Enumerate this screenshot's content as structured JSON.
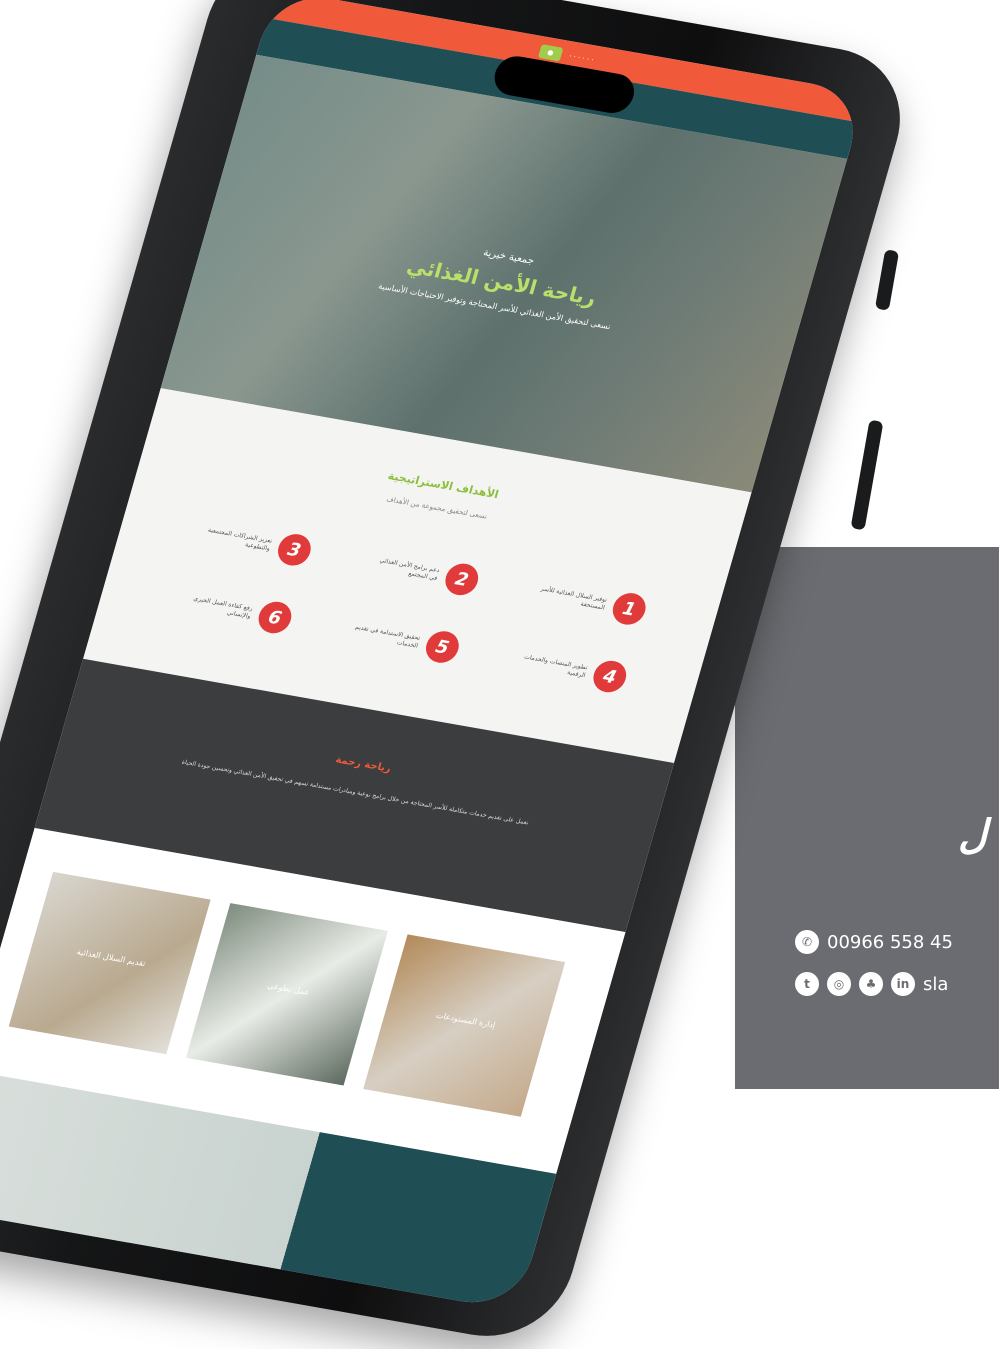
{
  "card": {
    "title": "ل",
    "phone": "00966 558 45",
    "handle": "sla",
    "icons": [
      "whatsapp-icon",
      "twitter-icon",
      "instagram-icon",
      "snapchat-icon",
      "linkedin-icon"
    ]
  },
  "phone_screen": {
    "hero": {
      "kicker": "جمعية خيرية",
      "title": "رياحة الأمن الغذائي",
      "description": "نسعى لتحقيق الأمن الغذائي للأسر المحتاجة وتوفير الاحتياجات الأساسية"
    },
    "goals": {
      "title": "الأهداف الاستراتيجية",
      "subtitle": "نسعى لتحقيق مجموعة من الأهداف",
      "items": [
        {
          "num": "1",
          "text": "توفير السلال الغذائية للأسر المستحقة"
        },
        {
          "num": "2",
          "text": "دعم برامج الأمن الغذائي في المجتمع"
        },
        {
          "num": "3",
          "text": "تعزيز الشراكات المجتمعية والتطوعية"
        },
        {
          "num": "4",
          "text": "تطوير المنصات والخدمات الرقمية"
        },
        {
          "num": "5",
          "text": "تحقيق الاستدامة في تقديم الخدمات"
        },
        {
          "num": "6",
          "text": "رفع كفاءة العمل الخيري والإنساني"
        }
      ]
    },
    "about": {
      "title": "رياحة رحمة",
      "text": "نعمل على تقديم خدمات متكاملة للأسر المحتاجة من خلال برامج نوعية ومبادرات مستدامة تسهم في تحقيق الأمن الغذائي وتحسين جودة الحياة"
    },
    "photos": [
      {
        "caption": "تقديم السلال الغذائية"
      },
      {
        "caption": "عمل تطوعي"
      },
      {
        "caption": "إدارة المستودعات"
      }
    ],
    "colors": {
      "accent": "#f05a3a",
      "green": "#8bbf3c",
      "teal": "#1f4f55",
      "red": "#e13a3a"
    }
  }
}
